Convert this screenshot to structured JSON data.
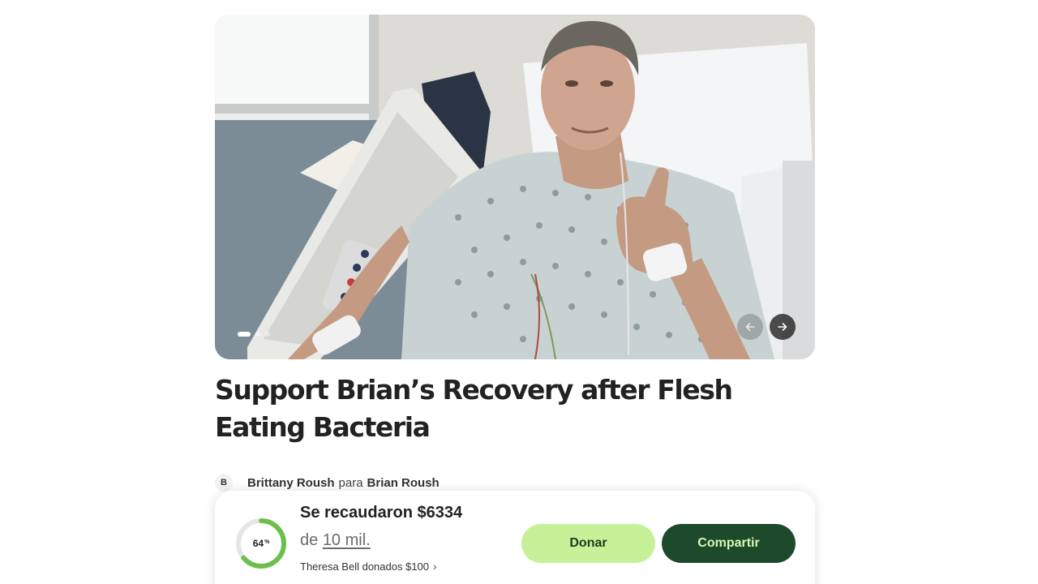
{
  "campaign": {
    "title": "Support Brian’s Recovery after Flesh Eating Bacteria"
  },
  "carousel": {
    "total_slides": 3,
    "active_slide": 1
  },
  "organizer": {
    "avatar_initial": "B",
    "organizer_name": "Brittany Roush",
    "connector": "para",
    "beneficiary_name": "Brian Roush"
  },
  "donation": {
    "progress_percent": 64,
    "progress_label": "64",
    "progress_unit": "%",
    "raised_text": "Se recaudaron $6334",
    "goal_prefix": "de",
    "goal_amount": "10 mil.",
    "recent_donation": "Theresa Bell donados $100",
    "donate_label": "Donar",
    "share_label": "Compartir"
  },
  "colors": {
    "progress_track": "#e6e6e6",
    "progress_fill": "#6cc04a",
    "donate_bg": "#c7f198",
    "share_bg": "#1e4a2c",
    "share_text": "#d8f7b4"
  },
  "icons": {
    "prev": "arrow-left-icon",
    "next": "arrow-right-icon",
    "recent_chevron": "chevron-right-icon"
  }
}
